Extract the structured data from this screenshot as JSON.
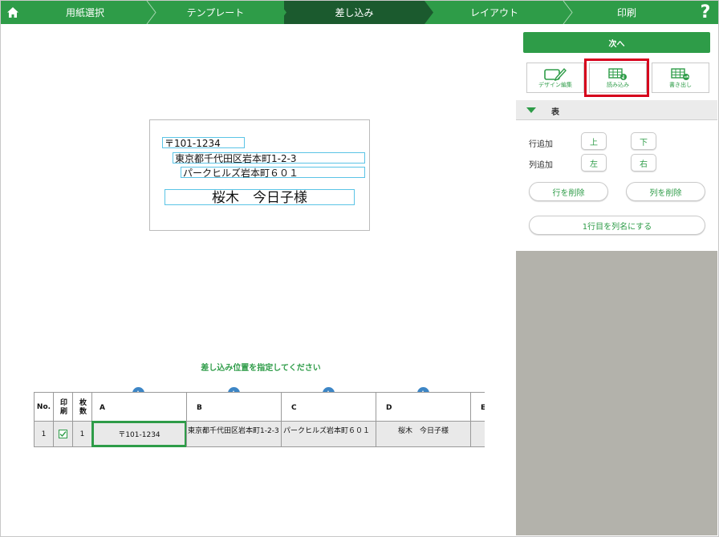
{
  "nav": {
    "steps": [
      "用紙選択",
      "テンプレート",
      "差し込み",
      "レイアウト",
      "印刷"
    ],
    "help": "?"
  },
  "preview": {
    "postal": "〒101-1234",
    "address1": "東京都千代田区岩本町1-2-3",
    "address2": "パークヒルズ岩本町６０１",
    "name": "桜木　今日子様"
  },
  "instruction": "差し込み位置を指定してください",
  "table": {
    "headers": [
      "No.",
      "印刷",
      "枚数",
      "A",
      "B",
      "C",
      "D",
      "E"
    ],
    "row": {
      "no": "1",
      "count": "1",
      "a": "〒101-1234",
      "b": "東京都千代田区岩本町1-2-3",
      "c": "パークヒルズ岩本町６０１",
      "d": "桜木　今日子様"
    }
  },
  "panel": {
    "next": "次へ",
    "tools": [
      "デザイン編集",
      "読み込み",
      "書き出し"
    ],
    "section": "表",
    "row_add": "行追加",
    "col_add": "列追加",
    "up": "上",
    "down": "下",
    "left": "左",
    "right": "右",
    "delete_row": "行を削除",
    "delete_col": "列を削除",
    "first_row_header": "1行目を列名にする"
  },
  "colors": {
    "accent": "#2e9c48",
    "active_step": "#1b5a2e",
    "highlight": "#d6001c",
    "field_border": "#5bc4e6"
  }
}
